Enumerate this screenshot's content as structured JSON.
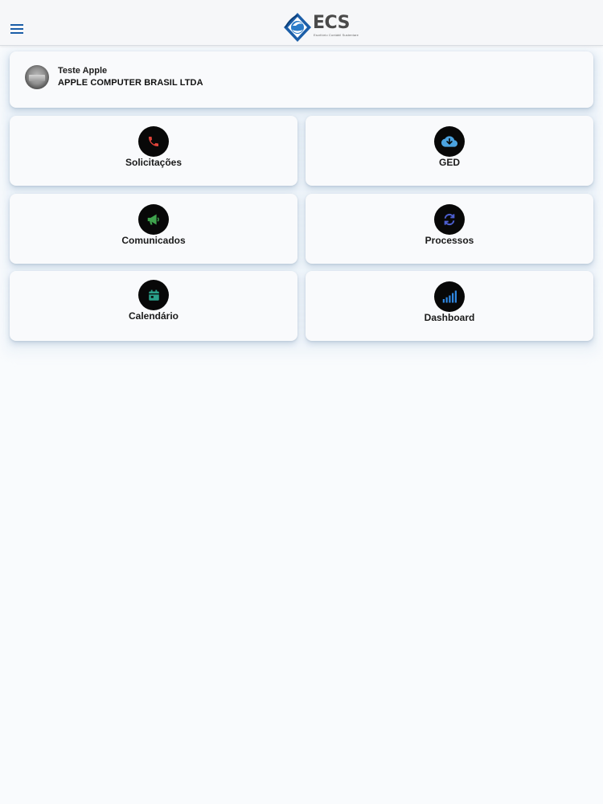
{
  "header": {
    "menu_icon": "hamburger-menu-icon",
    "logo_text": "ECS",
    "logo_subtitle": "Escritório Contábil Sustentare",
    "brand_color": "#1b5ea8"
  },
  "profile": {
    "user_name": "Teste Apple",
    "company_name": "APPLE COMPUTER BRASIL LTDA"
  },
  "tiles": [
    {
      "label": "Solicitações",
      "icon": "phone-icon",
      "icon_color": "#e0443a"
    },
    {
      "label": "GED",
      "icon": "cloud-download-icon",
      "icon_color": "#4ba3e0"
    },
    {
      "label": "Comunicados",
      "icon": "megaphone-icon",
      "icon_color": "#3fa34d"
    },
    {
      "label": "Processos",
      "icon": "refresh-icon",
      "icon_color": "#4d5fd1"
    },
    {
      "label": "Calendário",
      "icon": "calendar-icon",
      "icon_color": "#2aa08a"
    },
    {
      "label": "Dashboard",
      "icon": "signal-bars-icon",
      "icon_color": "#2e86e0"
    }
  ]
}
